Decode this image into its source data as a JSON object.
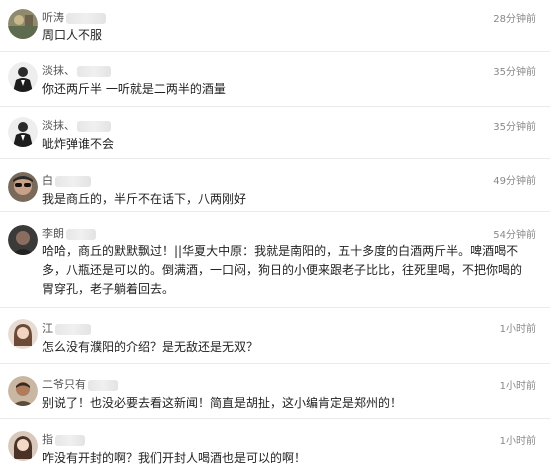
{
  "comments": [
    {
      "name": "听涛",
      "time": "28分钟前",
      "text": "周口人不服",
      "avatar_icon": "avatar-landscape-icon"
    },
    {
      "name": "淡抹、",
      "time": "35分钟前",
      "text": "你还两斤半  一听就是二两半的酒量",
      "avatar_icon": "avatar-man-suit-icon"
    },
    {
      "name": "淡抹、",
      "time": "35分钟前",
      "text": "呲炸弹谁不会",
      "avatar_icon": "avatar-man-suit-icon"
    },
    {
      "name": "白",
      "time": "49分钟前",
      "text": "我是商丘的，半斤不在话下，八两刚好",
      "avatar_icon": "avatar-man-sunglasses-icon"
    },
    {
      "name": "李朗",
      "time": "54分钟前",
      "text": "哈哈，商丘的默默飘过！||华夏大中原：我就是南阳的，五十多度的白酒两斤半。啤酒喝不多，八瓶还是可以的。倒满酒，一口闷，狗日的小便来跟老子比比，往死里喝，不把你喝的胃穿孔，老子躺着回去。",
      "avatar_icon": "avatar-person-dark-icon"
    },
    {
      "name": "江",
      "time": "1小时前",
      "text": "怎么没有濮阳的介绍？是无敌还是无双？",
      "avatar_icon": "avatar-woman-icon"
    },
    {
      "name": "二爷只有",
      "time": "1小时前",
      "text": "别说了！也没必要去看这新闻！简直是胡扯，这小编肯定是郑州的！",
      "avatar_icon": "avatar-man-portrait-icon"
    },
    {
      "name": "指",
      "time": "1小时前",
      "text": "咋没有开封的啊？我们开封人喝酒也是可以的啊！",
      "avatar_icon": "avatar-woman-photo-icon"
    }
  ]
}
